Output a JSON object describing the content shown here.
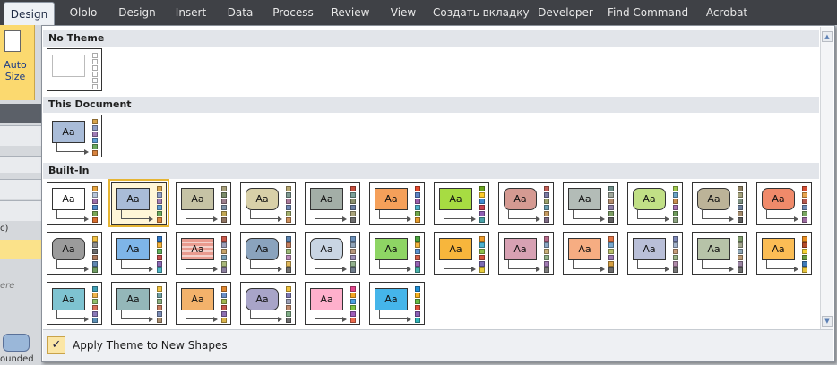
{
  "ribbon": {
    "tabs": [
      {
        "label": "Design",
        "active": true
      },
      {
        "label": "Ololo"
      },
      {
        "label": "Design"
      },
      {
        "label": "Insert"
      },
      {
        "label": "Data"
      },
      {
        "label": "Process"
      },
      {
        "label": "Review"
      },
      {
        "label": "View"
      },
      {
        "label": "Создать вкладку"
      },
      {
        "label": "Developer"
      },
      {
        "label": "Find Command"
      },
      {
        "label": "Acrobat"
      }
    ],
    "auto_size_label_1": "Auto",
    "auto_size_label_2": "Size",
    "left_fragments": {
      "c": "c)",
      "ere": "ere",
      "rounded": "ounded"
    }
  },
  "gallery": {
    "sections": {
      "no_theme": "No Theme",
      "this_document": "This Document",
      "built_in": "Built-In"
    },
    "tile_text": "Aa",
    "no_theme_swatches": [
      "#ffffff",
      "#ffffff",
      "#ffffff",
      "#ffffff",
      "#ffffff",
      "#ffffff"
    ],
    "this_document_theme": {
      "fill": "#a9bcd8",
      "swatches": [
        "#d7a44a",
        "#8f9fc6",
        "#a17db5",
        "#5f9fd4",
        "#6aa95e",
        "#d8833e"
      ]
    },
    "built_in": [
      {
        "fill": "#ffffff",
        "round": false,
        "swatches": [
          "#e7a33d",
          "#b7c6db",
          "#9b6ea8",
          "#4e88c9",
          "#78a654",
          "#d66c2d"
        ]
      },
      {
        "fill": "#a9bcd8",
        "round": false,
        "selected": true,
        "swatches": [
          "#d7a44a",
          "#8f9fc6",
          "#a17db5",
          "#5f9fd4",
          "#6aa95e",
          "#d8833e"
        ]
      },
      {
        "fill": "#c6c3a5",
        "round": false,
        "swatches": [
          "#a8a07a",
          "#7b8c6a",
          "#9b7f8e",
          "#7d91a8",
          "#c2a653",
          "#8e7360"
        ]
      },
      {
        "fill": "#d8d0a8",
        "round": true,
        "swatches": [
          "#b9a870",
          "#7f9a92",
          "#ab7a9b",
          "#6f88b3",
          "#a4b06c",
          "#cc8e5a"
        ]
      },
      {
        "fill": "#a3aea7",
        "round": false,
        "swatches": [
          "#c64d3b",
          "#7ca098",
          "#8a8f6c",
          "#6b7fa1",
          "#a9a37b",
          "#6d6d6d"
        ]
      },
      {
        "fill": "#f5a05a",
        "round": false,
        "swatches": [
          "#e6492d",
          "#5d83c6",
          "#9a5da9",
          "#4db0c9",
          "#70a84b",
          "#e59a2b"
        ]
      },
      {
        "fill": "#a7dc42",
        "round": false,
        "swatches": [
          "#6aa31f",
          "#ffcc2a",
          "#3f8bd1",
          "#c9414f",
          "#8f5fb5",
          "#4aa1a8"
        ]
      },
      {
        "fill": "#d59a92",
        "round": true,
        "swatches": [
          "#c45e55",
          "#7c7ca4",
          "#9aa16a",
          "#6a9fb2",
          "#c79b61",
          "#7d6a84"
        ]
      },
      {
        "fill": "#b3bcb7",
        "round": false,
        "swatches": [
          "#6d8e87",
          "#9fa79b",
          "#b48c6c",
          "#8d7ea7",
          "#7d9e64",
          "#5f5f5f"
        ]
      },
      {
        "fill": "#c1e086",
        "round": true,
        "swatches": [
          "#9fc94a",
          "#6aa5c8",
          "#c88d4d",
          "#a56fb1",
          "#6e9c5b",
          "#8aa27e"
        ]
      },
      {
        "fill": "#bcb398",
        "round": true,
        "swatches": [
          "#8c7e5e",
          "#a3a07a",
          "#7b8f7f",
          "#6a7d99",
          "#a38a6b",
          "#5b5b5b"
        ]
      },
      {
        "fill": "#f08a6a",
        "round": true,
        "swatches": [
          "#d54d32",
          "#e8a44e",
          "#b4584f",
          "#6e8ab5",
          "#7aa761",
          "#9b6a9e"
        ]
      },
      {
        "fill": "#9b9b9b",
        "round": true,
        "swatches": [
          "#f2c043",
          "#8f8f8f",
          "#6b6b6b",
          "#ad7a5c",
          "#5f86b0",
          "#6e9b62"
        ]
      },
      {
        "fill": "#7eb5e8",
        "round": false,
        "swatches": [
          "#2f78c9",
          "#f4b33b",
          "#62b15c",
          "#c74f4f",
          "#8c6bb6",
          "#4fb5c7"
        ]
      },
      {
        "fill": "#e99b8f",
        "round": false,
        "striped": true,
        "swatches": [
          "#c9584a",
          "#9d9fb8",
          "#c7a46a",
          "#7ba1b8",
          "#a9b77a",
          "#8a7e9c"
        ]
      },
      {
        "fill": "#8aa3bd",
        "round": true,
        "swatches": [
          "#5a83b0",
          "#c47e5e",
          "#9dba77",
          "#bb8bb8",
          "#e0b85a",
          "#6f6f6f"
        ]
      },
      {
        "fill": "#c9d5e3",
        "round": true,
        "swatches": [
          "#6a8fb9",
          "#8fa3b8",
          "#b7967b",
          "#9c8db5",
          "#91b08c",
          "#6f7c8a"
        ]
      },
      {
        "fill": "#8ed564",
        "round": false,
        "swatches": [
          "#4aa33d",
          "#f3b53d",
          "#5b93d2",
          "#d55f4a",
          "#9563b3",
          "#49b2a9"
        ]
      },
      {
        "fill": "#f7b63c",
        "round": false,
        "swatches": [
          "#ec9a2a",
          "#4db3d0",
          "#8cc04b",
          "#d6533e",
          "#7c6bb5",
          "#e8cc3c"
        ]
      },
      {
        "fill": "#d7a1b3",
        "round": false,
        "swatches": [
          "#b76a8a",
          "#8ca7c5",
          "#c8b078",
          "#93b289",
          "#a07ab2",
          "#7a7a7a"
        ]
      },
      {
        "fill": "#f6ad82",
        "round": false,
        "swatches": [
          "#e07546",
          "#78a9cf",
          "#b9c06a",
          "#9b79b2",
          "#d7a144",
          "#6a6a6a"
        ]
      },
      {
        "fill": "#b9bfd8",
        "round": false,
        "swatches": [
          "#7b86b7",
          "#a3b3cc",
          "#c79c78",
          "#9ab385",
          "#b08aa9",
          "#747474"
        ]
      },
      {
        "fill": "#b7c3a8",
        "round": false,
        "swatches": [
          "#7f9a6b",
          "#a2a58c",
          "#8ca4b3",
          "#bb9a74",
          "#9b85a3",
          "#6b6b6b"
        ]
      },
      {
        "fill": "#fbbd55",
        "round": false,
        "swatches": [
          "#e88d20",
          "#b44b2a",
          "#f3d132",
          "#6a9d3f",
          "#3f7ab8",
          "#e4c23c"
        ]
      },
      {
        "fill": "#7ec3d1",
        "round": false,
        "swatches": [
          "#3f9fb5",
          "#f0b44b",
          "#8fbf6a",
          "#d87059",
          "#8a79b8",
          "#5c8fb5"
        ]
      },
      {
        "fill": "#94b7b9",
        "round": false,
        "swatches": [
          "#f2c33f",
          "#6f9ea0",
          "#8ab07f",
          "#c77b5d",
          "#7a8cb6",
          "#a98e6f"
        ]
      },
      {
        "fill": "#f3b26b",
        "round": false,
        "swatches": [
          "#e0872f",
          "#6a8fc7",
          "#9fb64f",
          "#c4554c",
          "#8c6fb2",
          "#d9b34c"
        ]
      },
      {
        "fill": "#a8a4c8",
        "round": true,
        "swatches": [
          "#f0c13c",
          "#7d78b3",
          "#9b9fb6",
          "#c08a6e",
          "#7fad86",
          "#6d6d6d"
        ]
      },
      {
        "fill": "#ffb0cc",
        "round": false,
        "swatches": [
          "#e2468d",
          "#f6a623",
          "#4aa0e0",
          "#7dc242",
          "#9f5db8",
          "#ec6a4d"
        ]
      },
      {
        "fill": "#45b5ea",
        "round": false,
        "swatches": [
          "#1f8fd6",
          "#f7b21e",
          "#66bc46",
          "#e2503b",
          "#8a5fb6",
          "#31b5b8"
        ]
      }
    ]
  },
  "footer": {
    "apply_label": "Apply Theme to New Shapes",
    "apply_checked": "✓"
  }
}
